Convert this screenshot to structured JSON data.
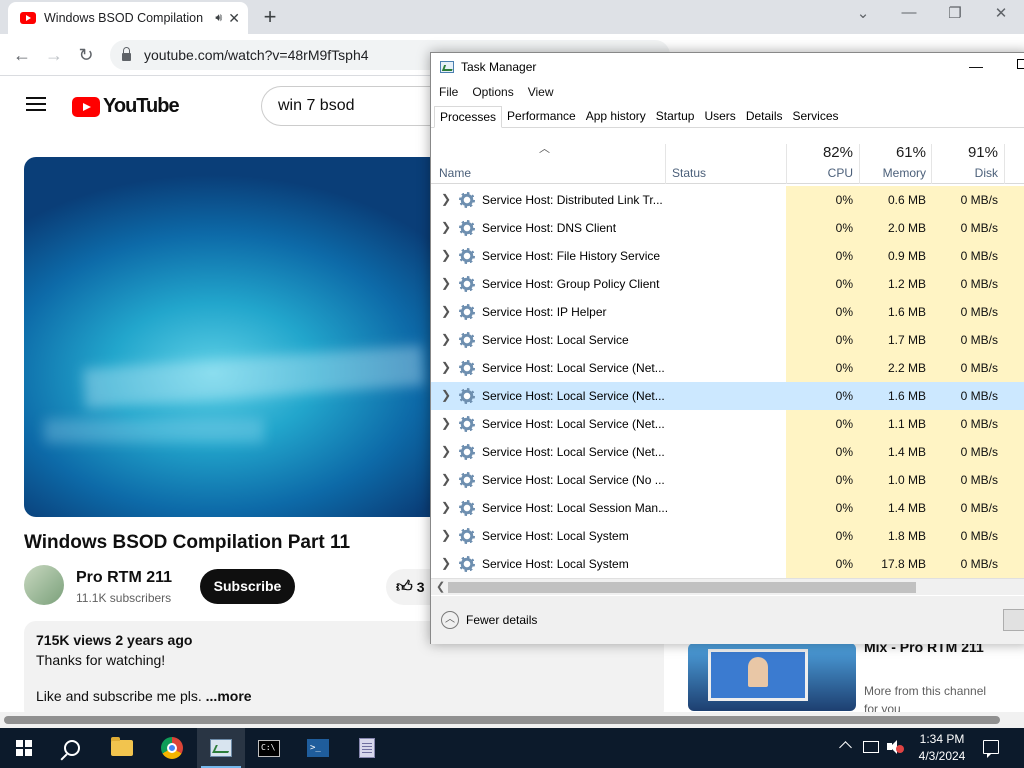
{
  "browser": {
    "tab_title": "Windows BSOD Compilation",
    "tab_audio_icon": "speaker-icon",
    "url": "youtube.com/watch?v=48rM9fTsph4",
    "new_tab": "+"
  },
  "youtube": {
    "logo_text": "YouTube",
    "search_value": "win 7 bsod",
    "video_title": "Windows BSOD Compilation Part 11",
    "channel_name": "Pro RTM 211",
    "subscribers": "11.1K subscribers",
    "subscribe_label": "Subscribe",
    "likes": "3",
    "description": {
      "meta": "715K views  2 years ago",
      "line1": "Thanks for watching!",
      "line2": "Like and subscribe me pls.",
      "more": "...more"
    },
    "recommended": {
      "title": "Mix - Pro RTM 211",
      "subtitle": "More from this channel for you"
    }
  },
  "task_manager": {
    "title": "Task Manager",
    "menu": [
      "File",
      "Options",
      "View"
    ],
    "tabs": [
      "Processes",
      "Performance",
      "App history",
      "Startup",
      "Users",
      "Details",
      "Services"
    ],
    "active_tab": "Processes",
    "columns": {
      "name": "Name",
      "status": "Status",
      "cpu_pct": "82%",
      "cpu": "CPU",
      "mem_pct": "61%",
      "mem": "Memory",
      "disk_pct": "91%",
      "disk": "Disk"
    },
    "rows": [
      {
        "name": "Service Host: Distributed Link Tr...",
        "cpu": "0%",
        "mem": "0.6 MB",
        "disk": "0 MB/s"
      },
      {
        "name": "Service Host: DNS Client",
        "cpu": "0%",
        "mem": "2.0 MB",
        "disk": "0 MB/s"
      },
      {
        "name": "Service Host: File History Service",
        "cpu": "0%",
        "mem": "0.9 MB",
        "disk": "0 MB/s"
      },
      {
        "name": "Service Host: Group Policy Client",
        "cpu": "0%",
        "mem": "1.2 MB",
        "disk": "0 MB/s"
      },
      {
        "name": "Service Host: IP Helper",
        "cpu": "0%",
        "mem": "1.6 MB",
        "disk": "0 MB/s"
      },
      {
        "name": "Service Host: Local Service",
        "cpu": "0%",
        "mem": "1.7 MB",
        "disk": "0 MB/s"
      },
      {
        "name": "Service Host: Local Service (Net...",
        "cpu": "0%",
        "mem": "2.2 MB",
        "disk": "0 MB/s"
      },
      {
        "name": "Service Host: Local Service (Net...",
        "cpu": "0%",
        "mem": "1.6 MB",
        "disk": "0 MB/s",
        "selected": true
      },
      {
        "name": "Service Host: Local Service (Net...",
        "cpu": "0%",
        "mem": "1.1 MB",
        "disk": "0 MB/s"
      },
      {
        "name": "Service Host: Local Service (Net...",
        "cpu": "0%",
        "mem": "1.4 MB",
        "disk": "0 MB/s"
      },
      {
        "name": "Service Host: Local Service (No ...",
        "cpu": "0%",
        "mem": "1.0 MB",
        "disk": "0 MB/s"
      },
      {
        "name": "Service Host: Local Session Man...",
        "cpu": "0%",
        "mem": "1.4 MB",
        "disk": "0 MB/s"
      },
      {
        "name": "Service Host: Local System",
        "cpu": "0%",
        "mem": "1.8 MB",
        "disk": "0 MB/s"
      },
      {
        "name": "Service Host: Local System",
        "cpu": "0%",
        "mem": "17.8 MB",
        "disk": "0 MB/s"
      }
    ],
    "fewer_details": "Fewer details"
  },
  "taskbar": {
    "time": "1:34 PM",
    "date": "4/3/2024",
    "pinned": [
      "start-icon",
      "search-icon",
      "file-explorer-icon",
      "chrome-icon",
      "task-manager-icon",
      "cmd-icon",
      "powershell-icon",
      "notepad-icon"
    ]
  },
  "colors": {
    "youtube_red": "#ff0000",
    "cpu_heat": "#fff4c4",
    "selection": "#cce8ff",
    "taskbar": "#0c1a2b"
  }
}
